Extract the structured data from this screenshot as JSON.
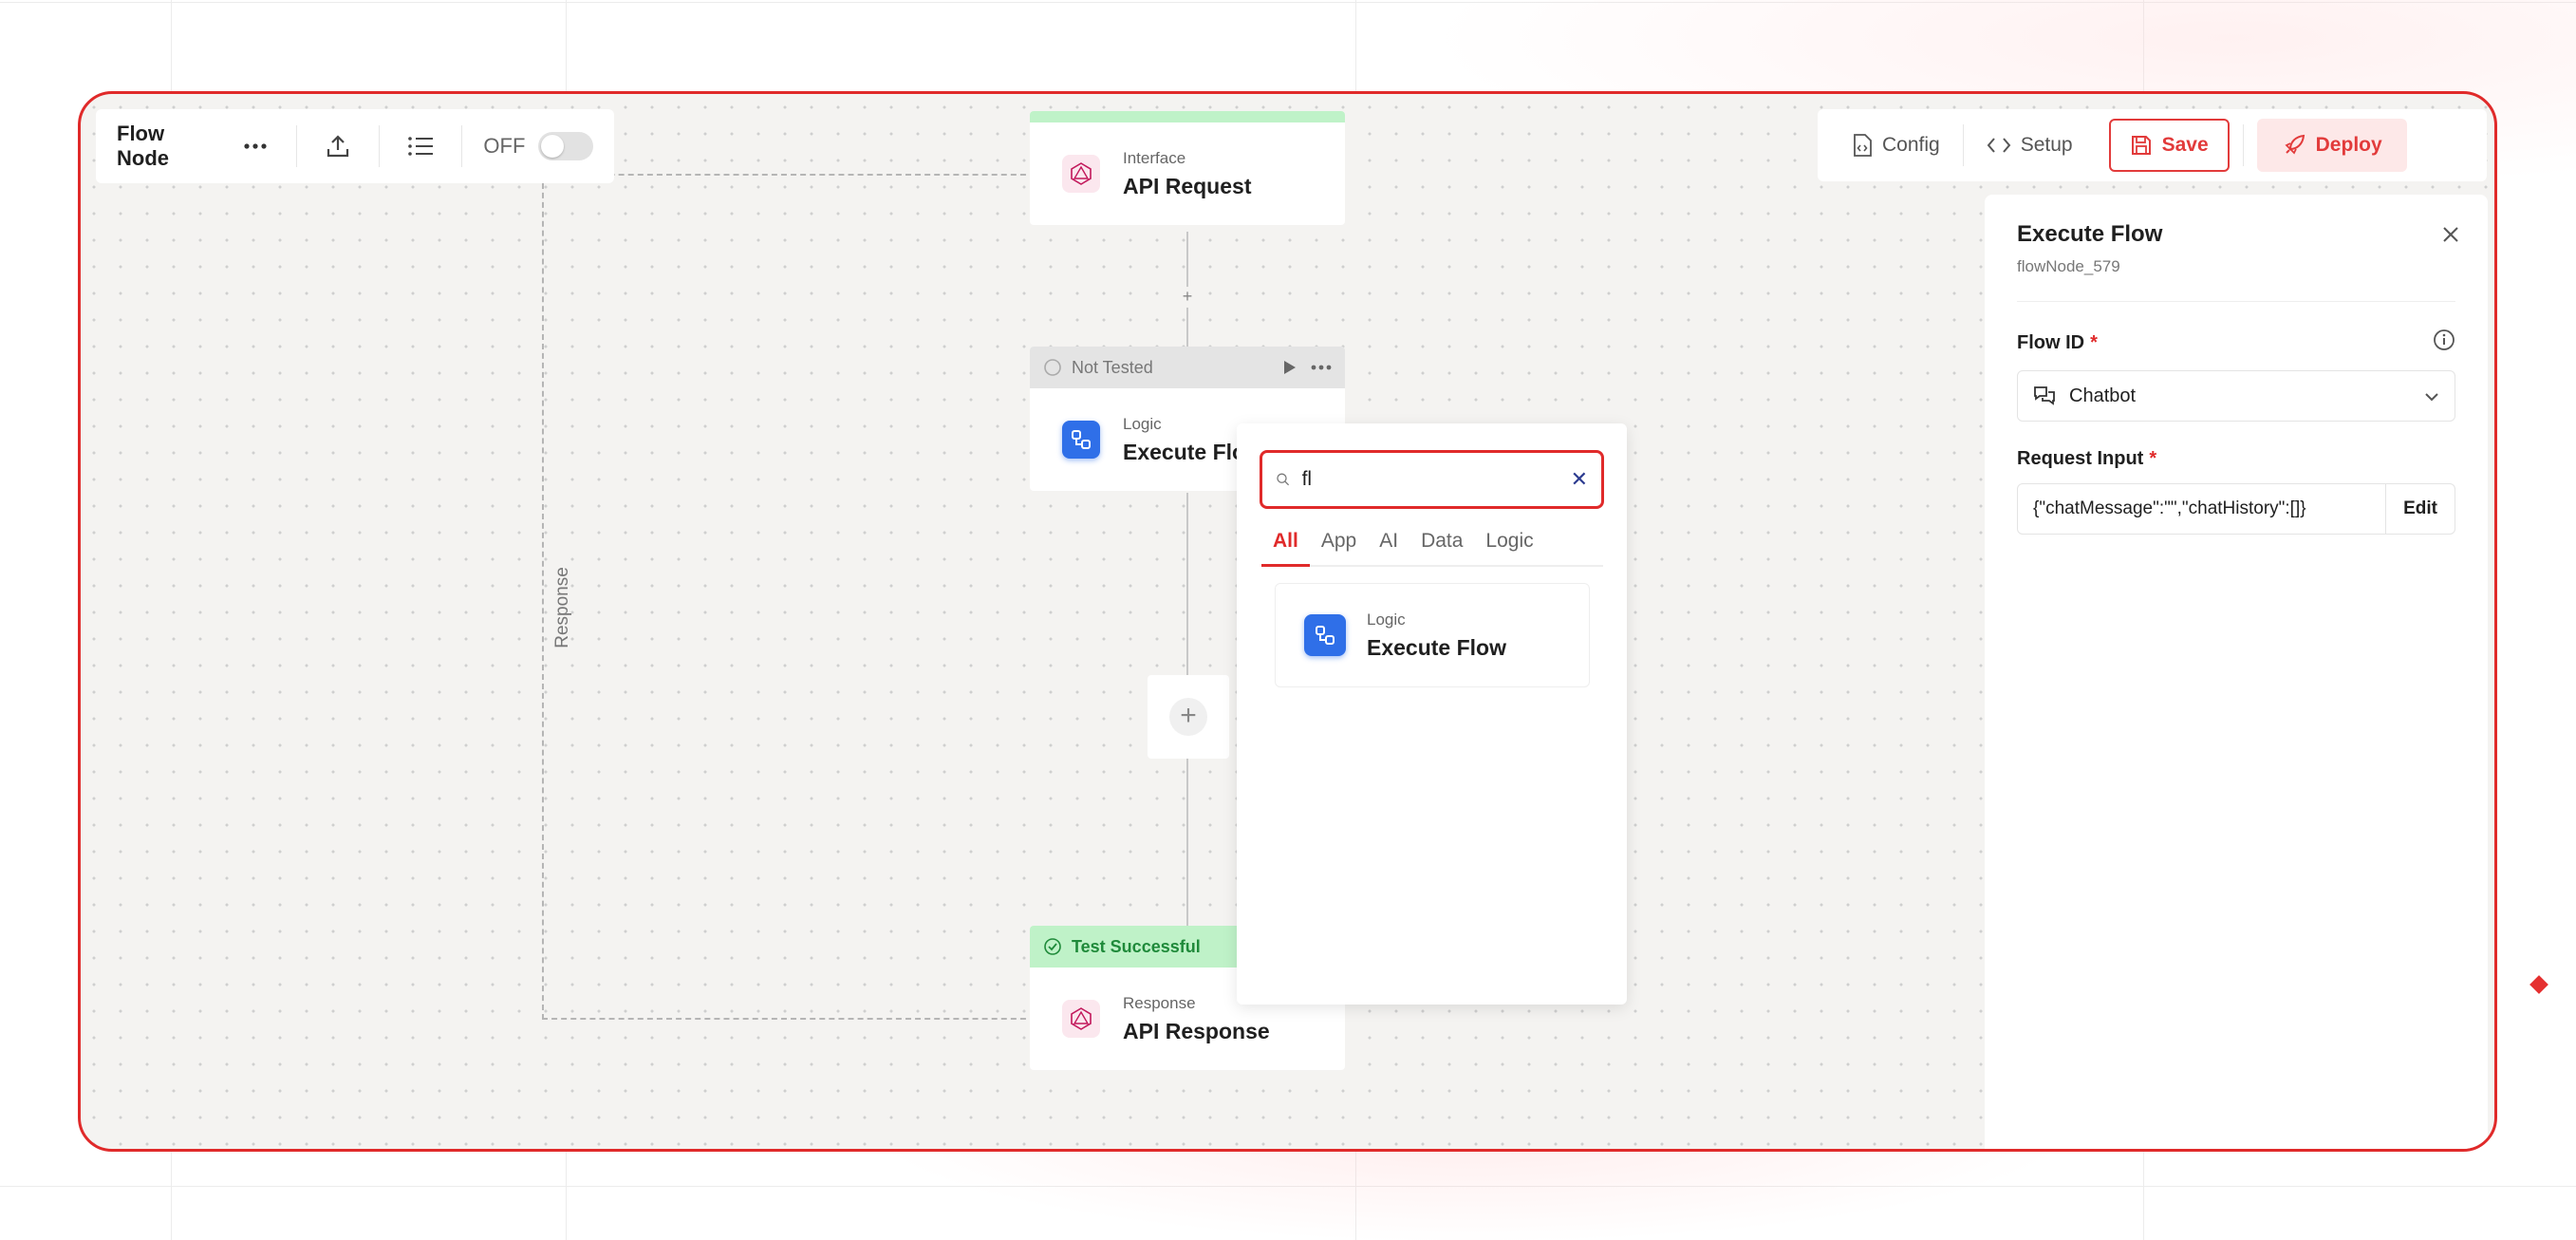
{
  "toolbar_left": {
    "title": "Flow Node",
    "toggle_label": "OFF"
  },
  "toolbar_right": {
    "config_label": "Config",
    "setup_label": "Setup",
    "save_label": "Save",
    "deploy_label": "Deploy"
  },
  "colors": {
    "accent": "#e02a2a",
    "success_bg": "#bff2c8",
    "logic_icon": "#2f6fe8"
  },
  "nodes": {
    "api_request": {
      "category": "Interface",
      "name": "API Request"
    },
    "execute_flow": {
      "status": "Not Tested",
      "category": "Logic",
      "name": "Execute Flow"
    },
    "api_response": {
      "status": "Test Successful",
      "category": "Response",
      "name": "API Response"
    }
  },
  "loop_label": "Response",
  "picker": {
    "search_value": "fl",
    "tabs": [
      "All",
      "App",
      "AI",
      "Data",
      "Logic"
    ],
    "active_tab": "All",
    "results": [
      {
        "category": "Logic",
        "name": "Execute Flow"
      }
    ]
  },
  "panel": {
    "title": "Execute Flow",
    "node_id": "flowNode_579",
    "flow_id_label": "Flow ID",
    "flow_id_value": "Chatbot",
    "request_input_label": "Request Input",
    "request_input_value": "{\"chatMessage\":\"\",\"chatHistory\":[]}",
    "edit_label": "Edit",
    "required_mark": "*"
  }
}
